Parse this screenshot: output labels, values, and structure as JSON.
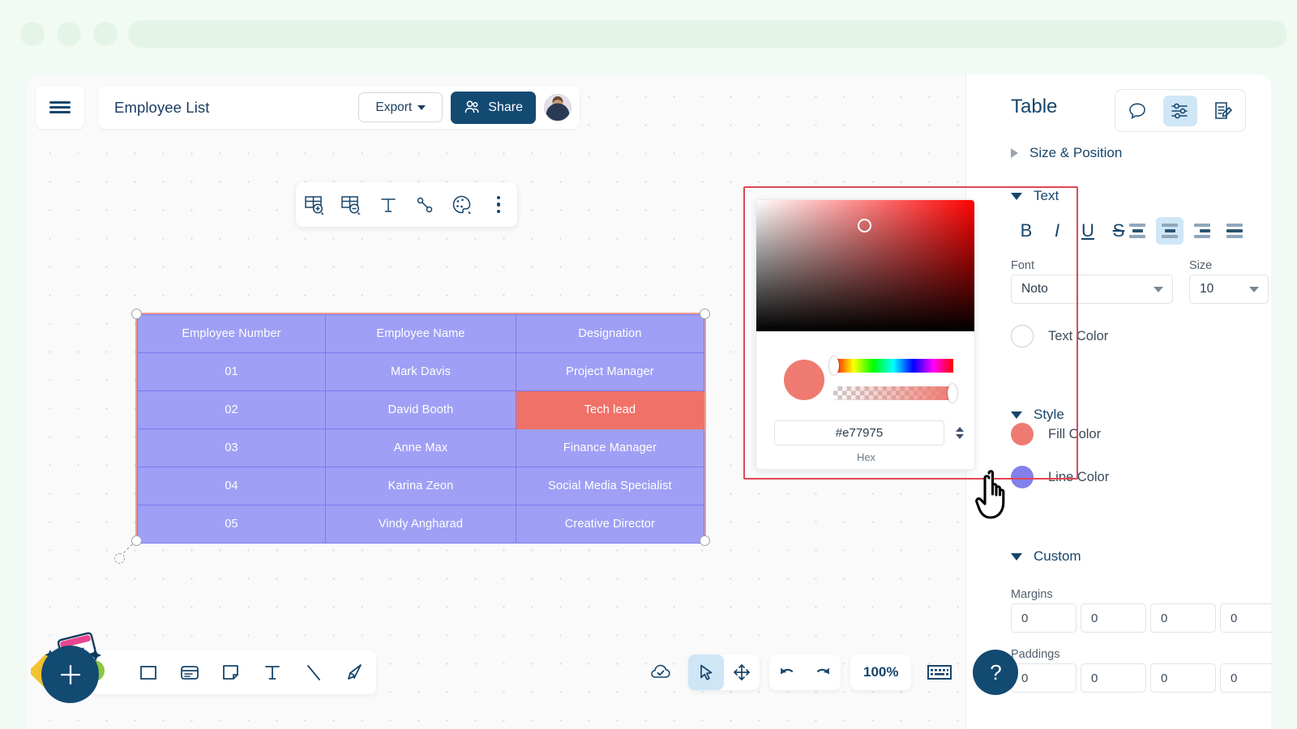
{
  "browser": {
    "dots": [
      "dot-1",
      "dot-2",
      "dot-3"
    ],
    "urlbar_value": ""
  },
  "header": {
    "menu_icon": "hamburger-icon",
    "doc_title": "Employee List",
    "export_label": "Export",
    "export_caret_icon": "chevron-down-icon",
    "share_label": "Share",
    "share_icon": "people-icon",
    "avatar_icon": "user-avatar"
  },
  "shape_toolbar": {
    "items": [
      {
        "name": "add-row-icon",
        "label": ""
      },
      {
        "name": "delete-row-icon",
        "label": ""
      },
      {
        "name": "text-icon",
        "label": ""
      },
      {
        "name": "connector-icon",
        "label": ""
      },
      {
        "name": "palette-icon",
        "label": ""
      },
      {
        "name": "more-options-icon",
        "label": ""
      }
    ]
  },
  "table": {
    "headers": [
      "Employee Number",
      "Employee Name",
      "Designation"
    ],
    "rows": [
      [
        "01",
        "Mark Davis",
        "Project Manager"
      ],
      [
        "02",
        "David Booth",
        "Tech lead"
      ],
      [
        "03",
        "Anne Max",
        "Finance Manager"
      ],
      [
        "04",
        "Karina Zeon",
        "Social Media Specialist"
      ],
      [
        "05",
        "Vindy Angharad",
        "Creative Director"
      ]
    ],
    "highlighted_cell": {
      "row": 1,
      "col": 2,
      "value": "Tech lead"
    },
    "fill_color": "#9f9ff5",
    "highlight_color": "#f07167",
    "selection_border_color": "#ef9e8e"
  },
  "color_picker": {
    "hex_value": "#e77975",
    "hex_label": "Hex",
    "current_color": "#ee7a71",
    "stepper_icon": "spinner-icon",
    "cursor_icon": "picker-ring-icon"
  },
  "sidebar": {
    "title": "Table",
    "tabs": [
      {
        "name": "comments-tab",
        "icon": "comment-icon",
        "active": false
      },
      {
        "name": "properties-tab",
        "icon": "sliders-icon",
        "active": true
      },
      {
        "name": "notes-tab",
        "icon": "note-edit-icon",
        "active": false
      }
    ],
    "sections": {
      "size_position": {
        "label": "Size & Position",
        "expanded": false
      },
      "text": {
        "label": "Text",
        "expanded": true
      },
      "style": {
        "label": "Style",
        "expanded": true
      },
      "custom": {
        "label": "Custom",
        "expanded": true
      }
    },
    "text_styles": [
      {
        "name": "bold-button",
        "label": "B"
      },
      {
        "name": "italic-button",
        "label": "I"
      },
      {
        "name": "underline-button",
        "label": "U"
      },
      {
        "name": "strikethrough-button",
        "label": "S"
      }
    ],
    "alignments": [
      {
        "name": "align-left-button",
        "active": false
      },
      {
        "name": "align-center-button",
        "active": true
      },
      {
        "name": "align-right-button",
        "active": false
      },
      {
        "name": "align-justify-button",
        "active": false
      }
    ],
    "font": {
      "label": "Font",
      "value": "Noto"
    },
    "size": {
      "label": "Size",
      "value": "10"
    },
    "text_color": {
      "label": "Text Color",
      "swatch": "#ffffff"
    },
    "fill_color": {
      "label": "Fill Color",
      "swatch": "#ee7a71"
    },
    "line_color": {
      "label": "Line Color",
      "swatch": "#8280ea"
    },
    "margins": {
      "label": "Margins",
      "values": [
        "0",
        "0",
        "0",
        "0"
      ]
    },
    "paddings": {
      "label": "Paddings",
      "values": [
        "0",
        "0",
        "0",
        "0"
      ]
    }
  },
  "bottom_left_toolbar": {
    "add_button_icon": "plus-icon",
    "tools": [
      {
        "name": "rectangle-tool",
        "icon": "square-icon"
      },
      {
        "name": "card-tool",
        "icon": "card-icon"
      },
      {
        "name": "sticky-note-tool",
        "icon": "note-icon"
      },
      {
        "name": "text-tool",
        "icon": "text-icon"
      },
      {
        "name": "line-tool",
        "icon": "line-icon"
      },
      {
        "name": "pen-tool",
        "icon": "pen-icon"
      }
    ]
  },
  "bottom_center_toolbar": {
    "save_status_icon": "cloud-check-icon",
    "select_tool_icon": "pointer-icon",
    "pan_tool_icon": "move-icon",
    "undo_icon": "undo-icon",
    "redo_icon": "redo-icon",
    "zoom_level": "100%",
    "keyboard_icon": "keyboard-icon",
    "help_label": "?"
  },
  "cursor": {
    "icon": "hand-pointer-cursor"
  }
}
